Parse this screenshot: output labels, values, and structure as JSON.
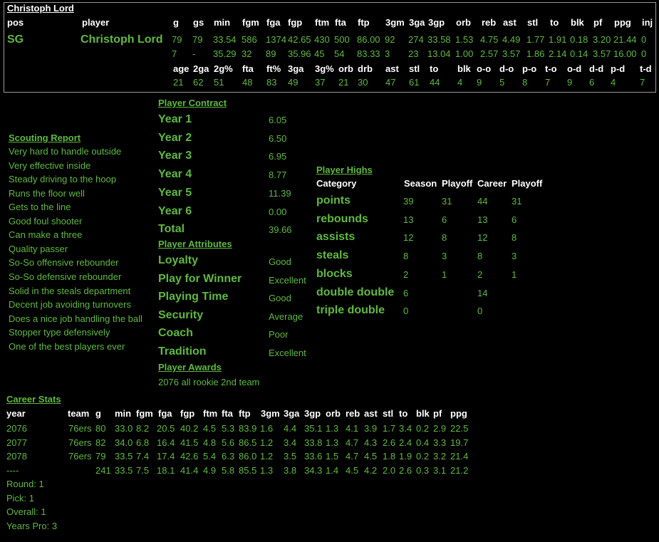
{
  "player_name": "Christoph Lord",
  "header_cols": [
    "pos",
    "player",
    "g",
    "gs",
    "min",
    "fgm",
    "fga",
    "fgp",
    "ftm",
    "fta",
    "ftp",
    "3gm",
    "3ga",
    "3gp",
    "orb",
    "reb",
    "ast",
    "stl",
    "to",
    "blk",
    "pf",
    "ppg",
    "inj"
  ],
  "season_row": {
    "pos": "SG",
    "player": "Christoph Lord",
    "values": [
      "79",
      "79",
      "33.54",
      "586",
      "1374",
      "42.65",
      "430",
      "500",
      "86.00",
      "92",
      "274",
      "33.58",
      "1.53",
      "4.75",
      "4.49",
      "1.77",
      "1.91",
      "0.18",
      "3.20",
      "21.44",
      "0"
    ]
  },
  "playoff_row": [
    "7",
    "-",
    "35.29",
    "32",
    "89",
    "35.96",
    "45",
    "54",
    "83.33",
    "3",
    "23",
    "13.04",
    "1.00",
    "2.57",
    "3.57",
    "1.86",
    "2.14",
    "0.14",
    "3.57",
    "16.00",
    "0"
  ],
  "ratings_cols": [
    "age",
    "2ga",
    "2g%",
    "fta",
    "ft%",
    "3ga",
    "3g%",
    "orb",
    "drb",
    "ast",
    "stl",
    "to",
    "blk",
    "o-o",
    "d-o",
    "p-o",
    "t-o",
    "o-d",
    "d-d",
    "p-d",
    "t-d"
  ],
  "ratings_vals": [
    "21",
    "62",
    "51",
    "48",
    "83",
    "49",
    "37",
    "21",
    "30",
    "47",
    "61",
    "44",
    "4",
    "9",
    "5",
    "8",
    "7",
    "9",
    "6",
    "4",
    "7"
  ],
  "scouting": {
    "title": "Scouting Report",
    "items": [
      "Very hard to handle outside",
      "Very effective inside",
      "Steady driving to the hoop",
      "Runs the floor well",
      "Gets to the line",
      "Good foul shooter",
      "Can make a three",
      "Quality passer",
      "So-So offensive rebounder",
      "So-So defensive rebounder",
      "Solid in the steals department",
      "Decent job avoiding turnovers",
      "Does a nice job handling the ball",
      "Stopper type defensively",
      "One of the best players ever"
    ]
  },
  "contract": {
    "title": "Player Contract",
    "rows": [
      {
        "label": "Year 1",
        "value": "6.05"
      },
      {
        "label": "Year 2",
        "value": "6.50"
      },
      {
        "label": "Year 3",
        "value": "6.95"
      },
      {
        "label": "Year 4",
        "value": "8.77"
      },
      {
        "label": "Year 5",
        "value": "11.39"
      },
      {
        "label": "Year 6",
        "value": "0.00"
      },
      {
        "label": "Total",
        "value": "39.66"
      }
    ]
  },
  "attributes": {
    "title": "Player Attributes",
    "rows": [
      {
        "label": "Loyalty",
        "value": "Good"
      },
      {
        "label": "Play for Winner",
        "value": "Excellent"
      },
      {
        "label": "Playing Time",
        "value": "Good"
      },
      {
        "label": "Security",
        "value": "Average"
      },
      {
        "label": "Coach",
        "value": "Poor"
      },
      {
        "label": "Tradition",
        "value": "Excellent"
      }
    ]
  },
  "awards": {
    "title": "Player Awards",
    "items": [
      "2076 all rookie 2nd team"
    ]
  },
  "highs": {
    "title": "Player Highs",
    "headers": [
      "Category",
      "Season",
      "Playoff",
      "Career",
      "Playoff"
    ],
    "rows": [
      {
        "cat": "points",
        "vals": [
          "39",
          "31",
          "44",
          "31"
        ]
      },
      {
        "cat": "rebounds",
        "vals": [
          "13",
          "6",
          "13",
          "6"
        ]
      },
      {
        "cat": "assists",
        "vals": [
          "12",
          "8",
          "12",
          "8"
        ]
      },
      {
        "cat": "steals",
        "vals": [
          "8",
          "3",
          "8",
          "3"
        ]
      },
      {
        "cat": "blocks",
        "vals": [
          "2",
          "1",
          "2",
          "1"
        ]
      },
      {
        "cat": "double double",
        "vals": [
          "6",
          "",
          "14",
          ""
        ]
      },
      {
        "cat": "triple double",
        "vals": [
          "0",
          "",
          "0",
          ""
        ]
      }
    ]
  },
  "career": {
    "title": "Career Stats",
    "headers": [
      "year",
      "team",
      "g",
      "min",
      "fgm",
      "fga",
      "fgp",
      "ftm",
      "fta",
      "ftp",
      "3gm",
      "3ga",
      "3gp",
      "orb",
      "reb",
      "ast",
      "stl",
      "to",
      "blk",
      "pf",
      "ppg"
    ],
    "rows": [
      [
        "2076",
        "76ers",
        "80",
        "33.0",
        "8.2",
        "20.5",
        "40.2",
        "4.5",
        "5.3",
        "83.9",
        "1.6",
        "4.4",
        "35.1",
        "1.3",
        "4.1",
        "3.9",
        "1.7",
        "3.4",
        "0.2",
        "2.9",
        "22.5"
      ],
      [
        "2077",
        "76ers",
        "82",
        "34.0",
        "6.8",
        "16.4",
        "41.5",
        "4.8",
        "5.6",
        "86.5",
        "1.2",
        "3.4",
        "33.8",
        "1.3",
        "4.7",
        "4.3",
        "2.6",
        "2.4",
        "0.4",
        "3.3",
        "19.7"
      ],
      [
        "2078",
        "76ers",
        "79",
        "33.5",
        "7.4",
        "17.4",
        "42.6",
        "5.4",
        "6.3",
        "86.0",
        "1.2",
        "3.5",
        "33.6",
        "1.5",
        "4.7",
        "4.5",
        "1.8",
        "1.9",
        "0.2",
        "3.2",
        "21.4"
      ],
      [
        "----",
        "",
        "241",
        "33.5",
        "7.5",
        "18.1",
        "41.4",
        "4.9",
        "5.8",
        "85.5",
        "1.3",
        "3.8",
        "34.3",
        "1.4",
        "4.5",
        "4.2",
        "2.0",
        "2.6",
        "0.3",
        "3.1",
        "21.2"
      ]
    ],
    "draft": [
      "Round: 1",
      "Pick: 1",
      "Overall: 1",
      "Years Pro: 3"
    ]
  }
}
